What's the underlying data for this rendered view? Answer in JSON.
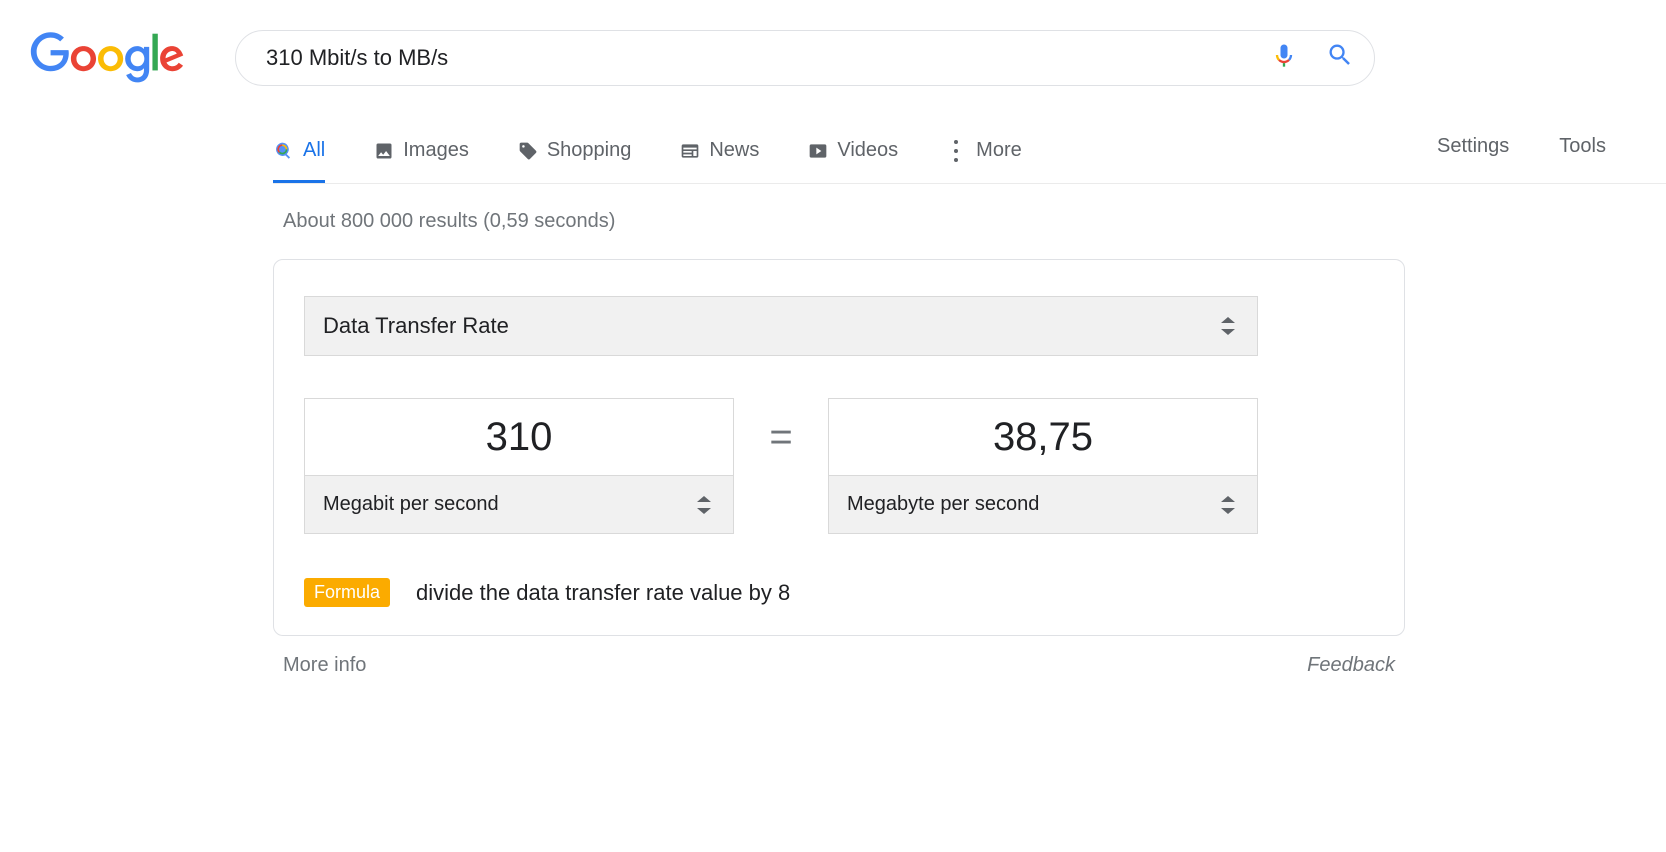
{
  "search": {
    "query": "310 Mbit/s to MB/s"
  },
  "tabs": {
    "all": "All",
    "images": "Images",
    "shopping": "Shopping",
    "news": "News",
    "videos": "Videos",
    "more": "More"
  },
  "rightLinks": {
    "settings": "Settings",
    "tools": "Tools"
  },
  "resultStats": "About 800 000 results (0,59 seconds)",
  "converter": {
    "category": "Data Transfer Rate",
    "inputValue": "310",
    "outputValue": "38,75",
    "inputUnit": "Megabit per second",
    "outputUnit": "Megabyte per second",
    "equals": "=",
    "formulaBadge": "Formula",
    "formulaText": "divide the data transfer rate value by 8"
  },
  "footer": {
    "moreInfo": "More info",
    "feedback": "Feedback"
  }
}
